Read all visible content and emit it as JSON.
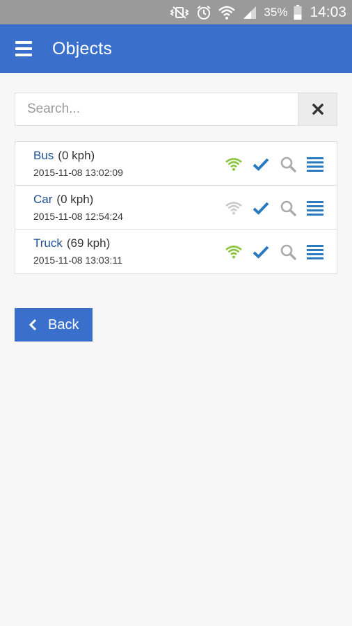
{
  "status_bar": {
    "battery_percent": "35%",
    "time": "14:03"
  },
  "app_bar": {
    "title": "Objects"
  },
  "search": {
    "placeholder": "Search...",
    "value": ""
  },
  "objects": [
    {
      "name": "Bus",
      "speed": "(0 kph)",
      "timestamp": "2015-11-08 13:02:09",
      "signal": "online"
    },
    {
      "name": "Car",
      "speed": "(0 kph)",
      "timestamp": "2015-11-08 12:54:24",
      "signal": "offline"
    },
    {
      "name": "Truck",
      "speed": "(69 kph)",
      "timestamp": "2015-11-08 13:03:11",
      "signal": "online"
    }
  ],
  "back_button": {
    "label": "Back"
  },
  "colors": {
    "primary": "#3a70cc",
    "signal_online": "#8bc53f",
    "signal_offline": "#cccccc",
    "check": "#2a7ac0",
    "search_icon": "#aaaaaa",
    "menu_lines": "#2a7ac0"
  },
  "icons": [
    "vibrate-icon",
    "alarm-icon",
    "wifi-icon",
    "cell-signal-icon",
    "battery-icon",
    "menu-icon",
    "close-icon",
    "wifi-signal-icon",
    "check-icon",
    "search-icon",
    "list-icon",
    "chevron-left-icon"
  ]
}
